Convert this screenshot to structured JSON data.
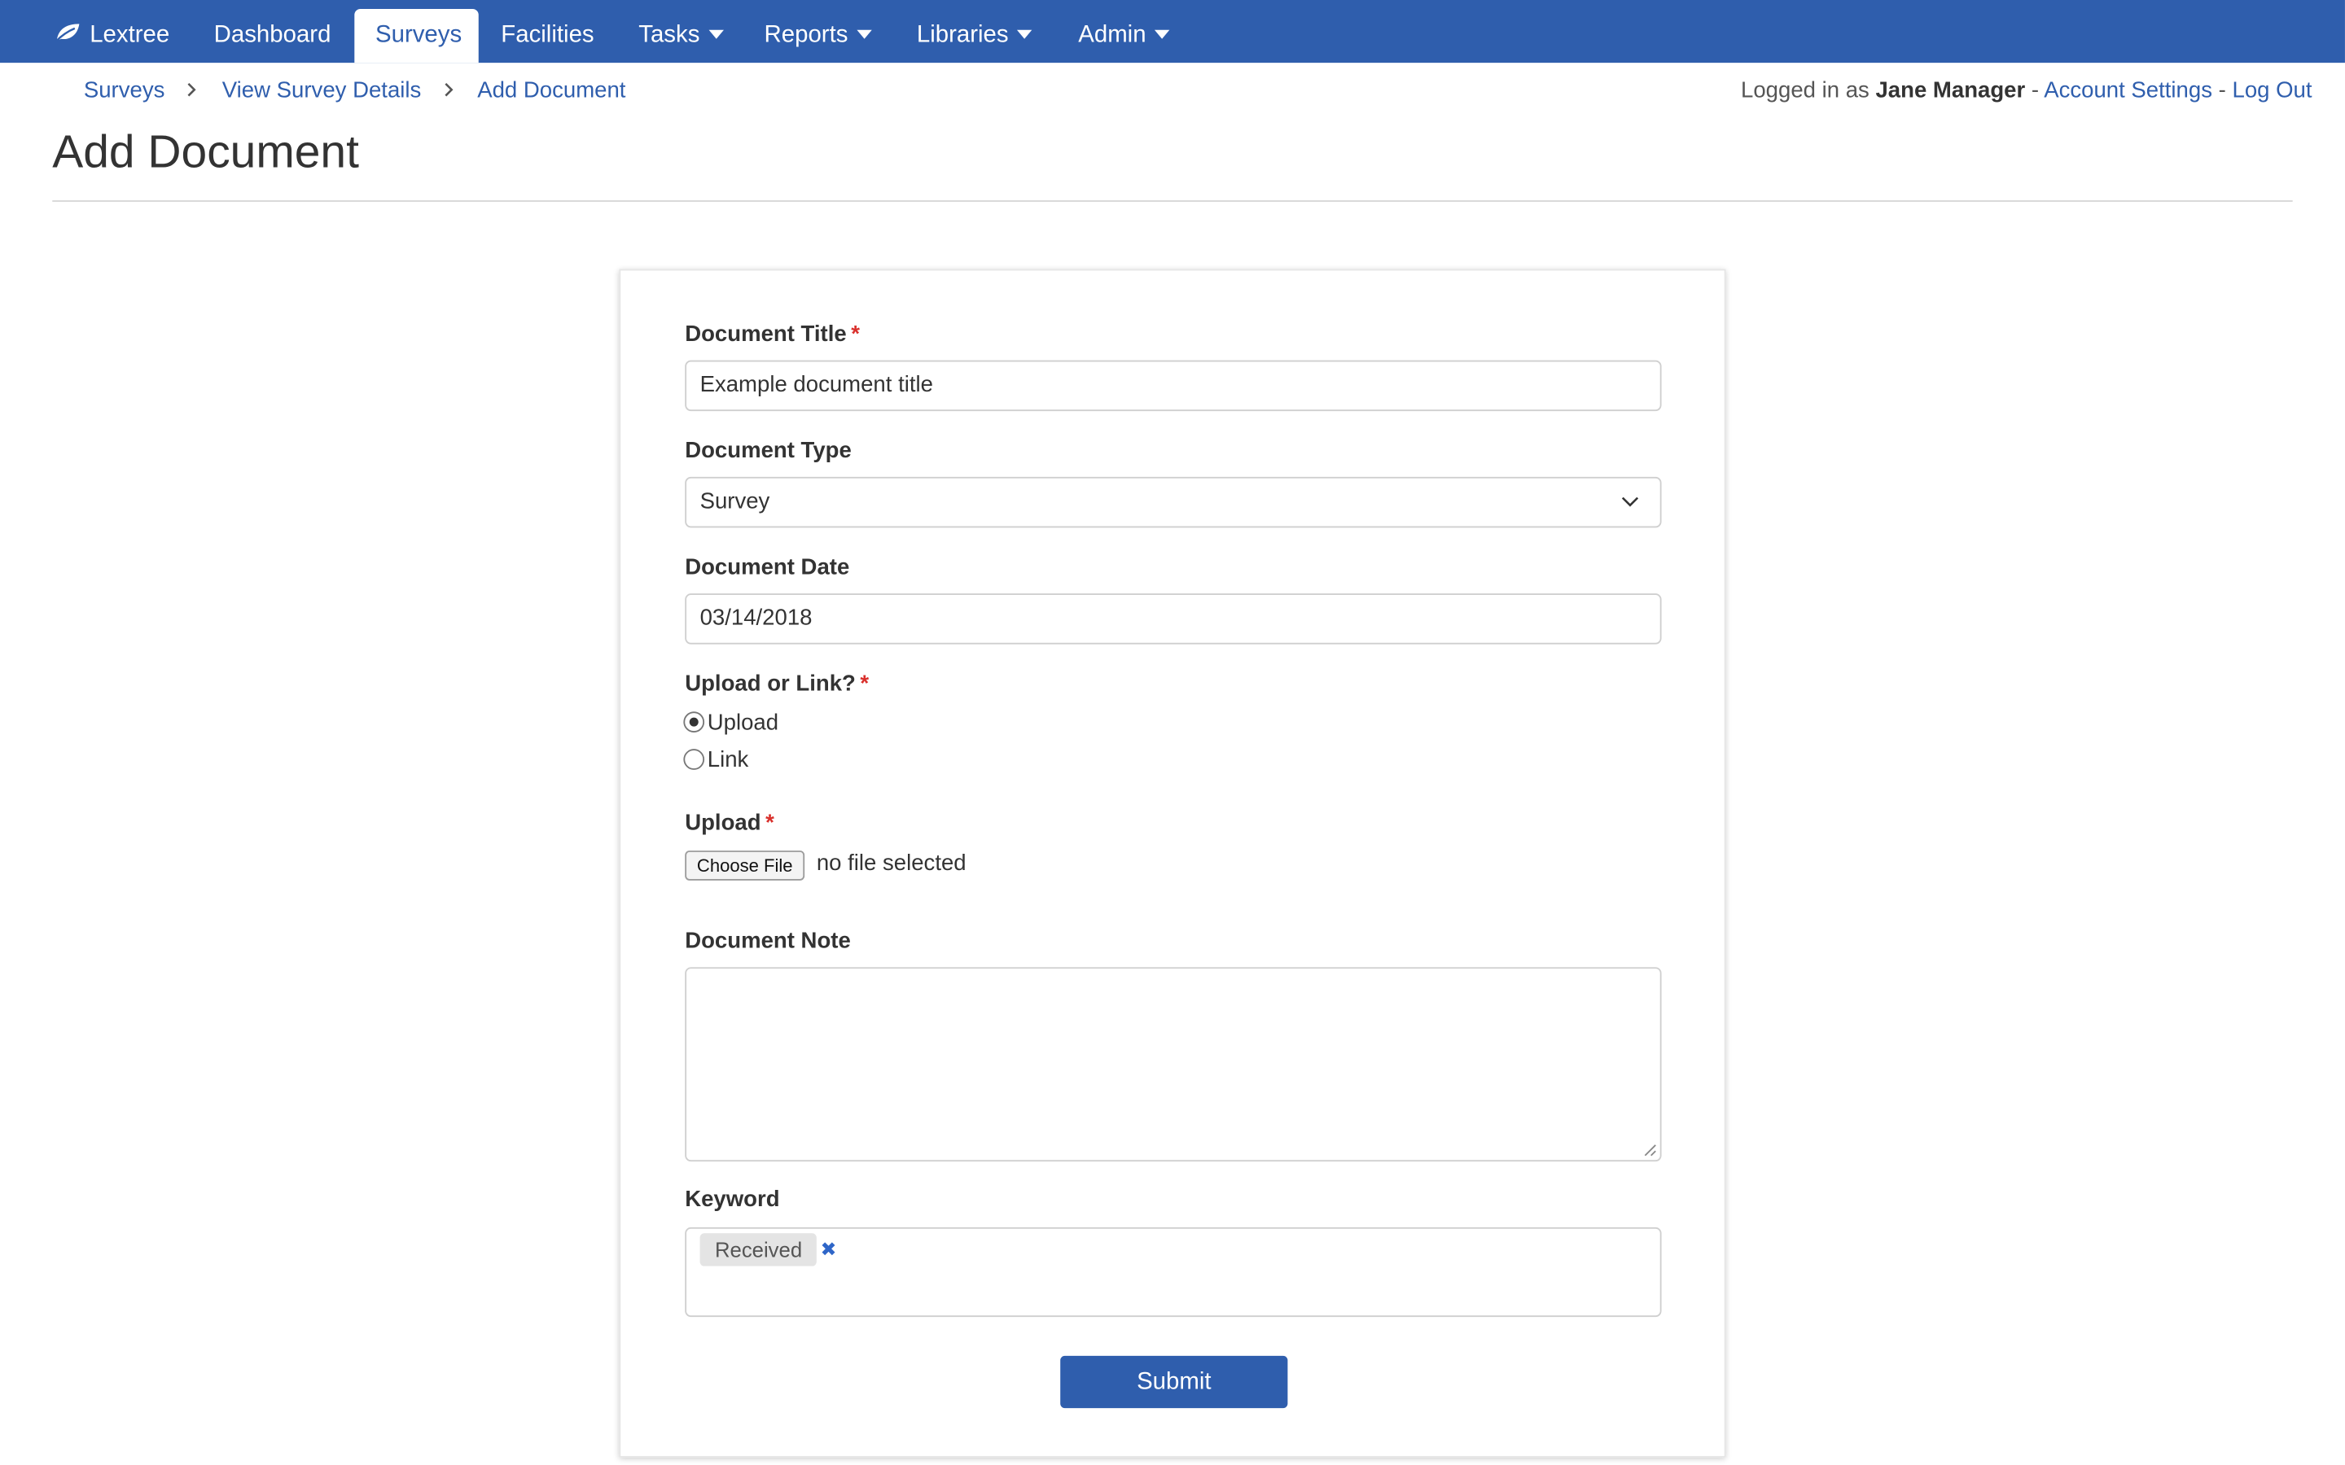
{
  "nav": {
    "brand": "Lextree",
    "items": [
      {
        "label": "Dashboard"
      },
      {
        "label": "Surveys"
      },
      {
        "label": "Facilities"
      },
      {
        "label": "Tasks"
      },
      {
        "label": "Reports"
      },
      {
        "label": "Libraries"
      },
      {
        "label": "Admin"
      }
    ],
    "active": "Surveys"
  },
  "breadcrumb": [
    "Surveys",
    "View Survey Details",
    "Add Document"
  ],
  "account": {
    "prefix": "Logged in as",
    "user": "Jane Manager",
    "separator": "-",
    "settings": "Account Settings",
    "logout": "Log Out"
  },
  "page_title": "Add Document",
  "form": {
    "required_mark": "*",
    "title": {
      "label": "Document Title",
      "value": "Example document title"
    },
    "type": {
      "label": "Document Type",
      "value": "Survey"
    },
    "date": {
      "label": "Document Date",
      "value": "03/14/2018"
    },
    "upload_or_link": {
      "label": "Upload or Link?",
      "options": [
        "Upload",
        "Link"
      ],
      "selected": "Upload"
    },
    "upload": {
      "label": "Upload",
      "button": "Choose File",
      "status": "no file selected"
    },
    "note": {
      "label": "Document Note",
      "value": ""
    },
    "keyword": {
      "label": "Keyword",
      "tags": [
        "Received"
      ],
      "remove_glyph": "✖"
    },
    "submit": "Submit"
  },
  "colors": {
    "brand": "#2f5ead",
    "required": "#d9302c",
    "tag_remove": "#2f66c8"
  },
  "icons": {
    "brand": "leaf-icon",
    "dropdown": "caret-down-icon",
    "breadcrumb_separator": "chevron-right-icon",
    "select": "chevron-down-icon"
  }
}
